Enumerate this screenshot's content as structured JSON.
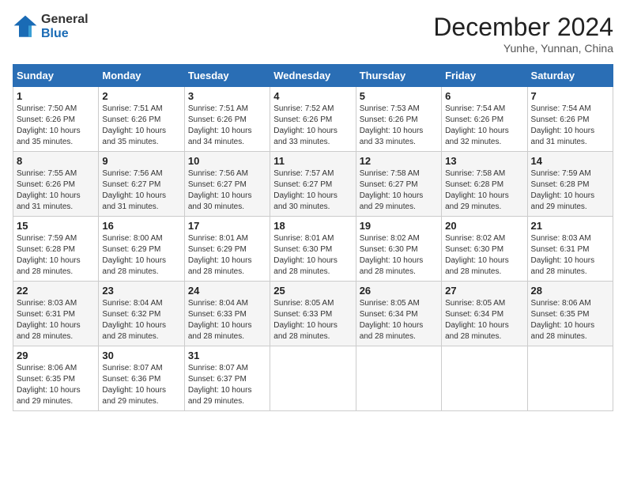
{
  "header": {
    "logo_general": "General",
    "logo_blue": "Blue",
    "month_year": "December 2024",
    "location": "Yunhe, Yunnan, China"
  },
  "calendar": {
    "days_of_week": [
      "Sunday",
      "Monday",
      "Tuesday",
      "Wednesday",
      "Thursday",
      "Friday",
      "Saturday"
    ],
    "weeks": [
      [
        {
          "day": "",
          "info": ""
        },
        {
          "day": "2",
          "info": "Sunrise: 7:51 AM\nSunset: 6:26 PM\nDaylight: 10 hours and 35 minutes."
        },
        {
          "day": "3",
          "info": "Sunrise: 7:51 AM\nSunset: 6:26 PM\nDaylight: 10 hours and 34 minutes."
        },
        {
          "day": "4",
          "info": "Sunrise: 7:52 AM\nSunset: 6:26 PM\nDaylight: 10 hours and 33 minutes."
        },
        {
          "day": "5",
          "info": "Sunrise: 7:53 AM\nSunset: 6:26 PM\nDaylight: 10 hours and 33 minutes."
        },
        {
          "day": "6",
          "info": "Sunrise: 7:54 AM\nSunset: 6:26 PM\nDaylight: 10 hours and 32 minutes."
        },
        {
          "day": "7",
          "info": "Sunrise: 7:54 AM\nSunset: 6:26 PM\nDaylight: 10 hours and 31 minutes."
        }
      ],
      [
        {
          "day": "1",
          "info": "Sunrise: 7:50 AM\nSunset: 6:26 PM\nDaylight: 10 hours and 35 minutes."
        },
        {
          "day": "9",
          "info": "Sunrise: 7:56 AM\nSunset: 6:27 PM\nDaylight: 10 hours and 31 minutes."
        },
        {
          "day": "10",
          "info": "Sunrise: 7:56 AM\nSunset: 6:27 PM\nDaylight: 10 hours and 30 minutes."
        },
        {
          "day": "11",
          "info": "Sunrise: 7:57 AM\nSunset: 6:27 PM\nDaylight: 10 hours and 30 minutes."
        },
        {
          "day": "12",
          "info": "Sunrise: 7:58 AM\nSunset: 6:27 PM\nDaylight: 10 hours and 29 minutes."
        },
        {
          "day": "13",
          "info": "Sunrise: 7:58 AM\nSunset: 6:28 PM\nDaylight: 10 hours and 29 minutes."
        },
        {
          "day": "14",
          "info": "Sunrise: 7:59 AM\nSunset: 6:28 PM\nDaylight: 10 hours and 29 minutes."
        }
      ],
      [
        {
          "day": "8",
          "info": "Sunrise: 7:55 AM\nSunset: 6:26 PM\nDaylight: 10 hours and 31 minutes."
        },
        {
          "day": "16",
          "info": "Sunrise: 8:00 AM\nSunset: 6:29 PM\nDaylight: 10 hours and 28 minutes."
        },
        {
          "day": "17",
          "info": "Sunrise: 8:01 AM\nSunset: 6:29 PM\nDaylight: 10 hours and 28 minutes."
        },
        {
          "day": "18",
          "info": "Sunrise: 8:01 AM\nSunset: 6:30 PM\nDaylight: 10 hours and 28 minutes."
        },
        {
          "day": "19",
          "info": "Sunrise: 8:02 AM\nSunset: 6:30 PM\nDaylight: 10 hours and 28 minutes."
        },
        {
          "day": "20",
          "info": "Sunrise: 8:02 AM\nSunset: 6:30 PM\nDaylight: 10 hours and 28 minutes."
        },
        {
          "day": "21",
          "info": "Sunrise: 8:03 AM\nSunset: 6:31 PM\nDaylight: 10 hours and 28 minutes."
        }
      ],
      [
        {
          "day": "15",
          "info": "Sunrise: 7:59 AM\nSunset: 6:28 PM\nDaylight: 10 hours and 28 minutes."
        },
        {
          "day": "23",
          "info": "Sunrise: 8:04 AM\nSunset: 6:32 PM\nDaylight: 10 hours and 28 minutes."
        },
        {
          "day": "24",
          "info": "Sunrise: 8:04 AM\nSunset: 6:33 PM\nDaylight: 10 hours and 28 minutes."
        },
        {
          "day": "25",
          "info": "Sunrise: 8:05 AM\nSunset: 6:33 PM\nDaylight: 10 hours and 28 minutes."
        },
        {
          "day": "26",
          "info": "Sunrise: 8:05 AM\nSunset: 6:34 PM\nDaylight: 10 hours and 28 minutes."
        },
        {
          "day": "27",
          "info": "Sunrise: 8:05 AM\nSunset: 6:34 PM\nDaylight: 10 hours and 28 minutes."
        },
        {
          "day": "28",
          "info": "Sunrise: 8:06 AM\nSunset: 6:35 PM\nDaylight: 10 hours and 28 minutes."
        }
      ],
      [
        {
          "day": "22",
          "info": "Sunrise: 8:03 AM\nSunset: 6:31 PM\nDaylight: 10 hours and 28 minutes."
        },
        {
          "day": "30",
          "info": "Sunrise: 8:07 AM\nSunset: 6:36 PM\nDaylight: 10 hours and 29 minutes."
        },
        {
          "day": "31",
          "info": "Sunrise: 8:07 AM\nSunset: 6:37 PM\nDaylight: 10 hours and 29 minutes."
        },
        {
          "day": "",
          "info": ""
        },
        {
          "day": "",
          "info": ""
        },
        {
          "day": "",
          "info": ""
        },
        {
          "day": "",
          "info": ""
        }
      ],
      [
        {
          "day": "29",
          "info": "Sunrise: 8:06 AM\nSunset: 6:35 PM\nDaylight: 10 hours and 29 minutes."
        },
        {
          "day": "",
          "info": ""
        },
        {
          "day": "",
          "info": ""
        },
        {
          "day": "",
          "info": ""
        },
        {
          "day": "",
          "info": ""
        },
        {
          "day": "",
          "info": ""
        },
        {
          "day": "",
          "info": ""
        }
      ]
    ]
  }
}
